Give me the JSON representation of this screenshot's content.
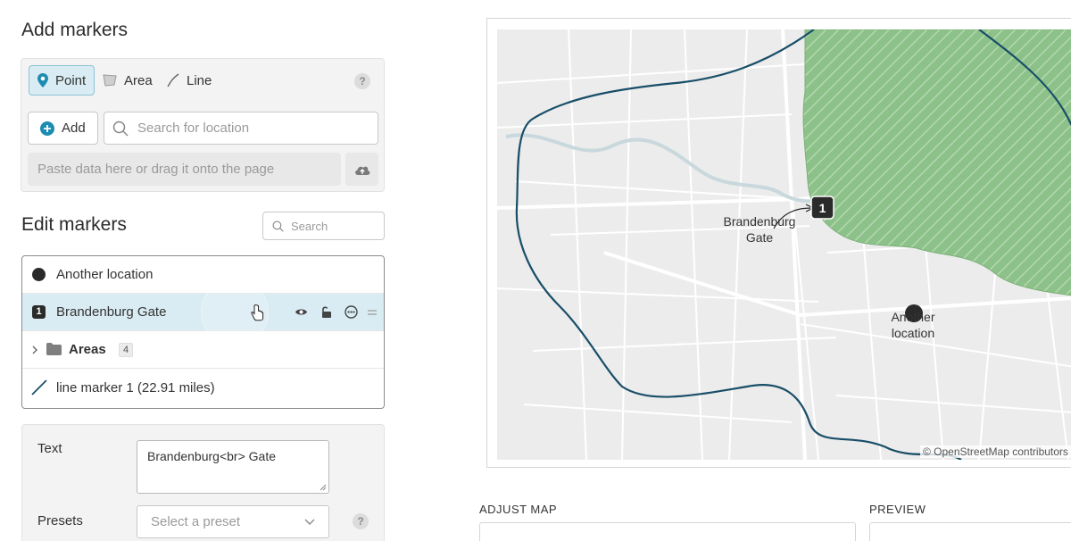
{
  "add_markers": {
    "heading": "Add markers",
    "types": [
      {
        "label": "Point",
        "icon": "pin-icon",
        "active": true
      },
      {
        "label": "Area",
        "icon": "area-icon",
        "active": false
      },
      {
        "label": "Line",
        "icon": "line-icon",
        "active": false
      }
    ],
    "help_label": "?",
    "add_label": "Add",
    "search_placeholder": "Search for location",
    "paste_placeholder": "Paste data here or drag it onto the page"
  },
  "edit_markers": {
    "heading": "Edit markers",
    "search_placeholder": "Search",
    "items": [
      {
        "label": "Another location",
        "icon": "dot-icon"
      },
      {
        "label": "Brandenburg Gate",
        "icon": "number-marker-icon",
        "number": "1"
      },
      {
        "label": "Areas",
        "icon": "folder-icon",
        "count": "4"
      },
      {
        "label": "line marker 1 (22.91 miles)",
        "icon": "line-icon"
      }
    ]
  },
  "marker_settings": {
    "text_label": "Text",
    "text_value": "Brandenburg<br> Gate",
    "presets_label": "Presets",
    "presets_placeholder": "Select a preset",
    "help_label": "?"
  },
  "map": {
    "marker_number": "1",
    "label_1": "Brandenburg",
    "label_2": "Gate",
    "another_1": "Another",
    "another_2": "location",
    "attribution": "© OpenStreetMap contributors"
  },
  "adjust_map": {
    "heading": "ADJUST MAP"
  },
  "preview": {
    "heading": "PREVIEW"
  },
  "colors": {
    "accent": "#1d8cb3",
    "selected_row": "#d9ecf3",
    "route": "#184e68",
    "area_fill": "#8dc18a"
  }
}
